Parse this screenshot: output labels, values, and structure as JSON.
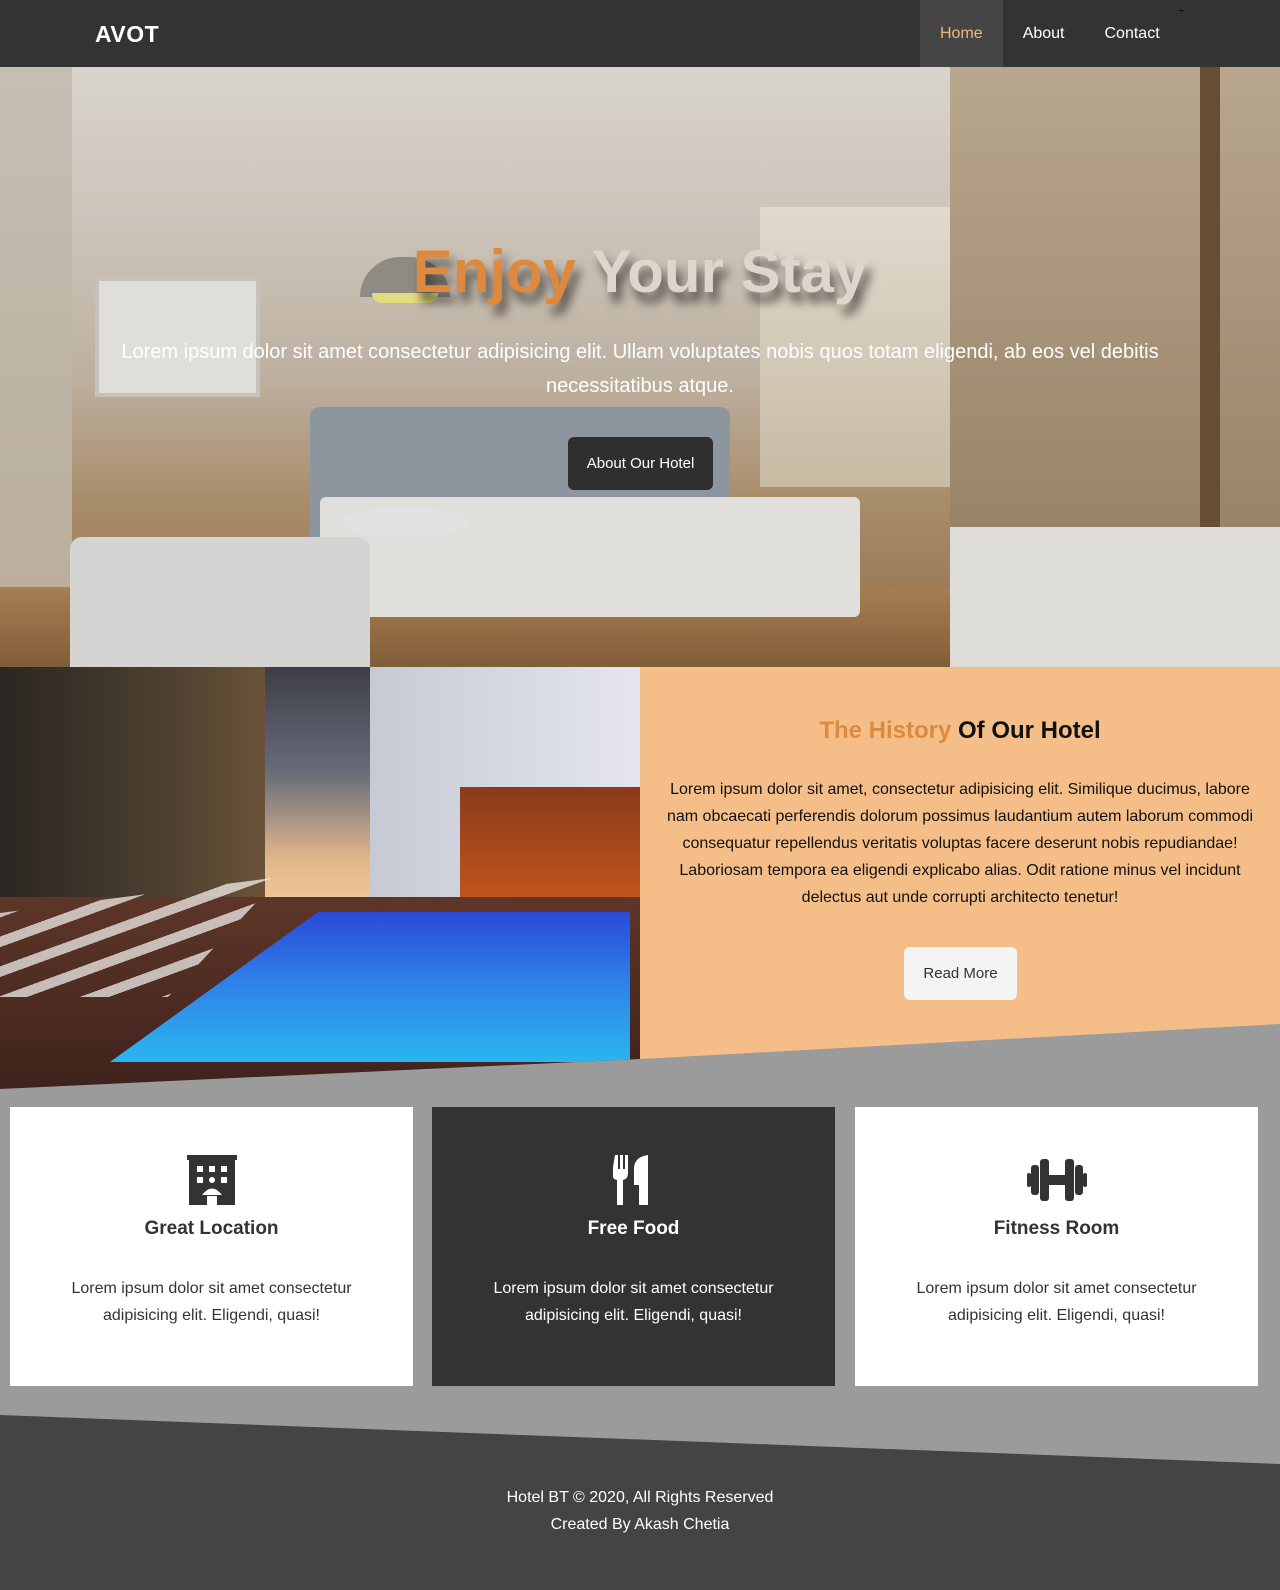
{
  "nav": {
    "logo": "AVOT",
    "links": [
      {
        "label": "Home",
        "active": true
      },
      {
        "label": "About",
        "active": false
      },
      {
        "label": "Contact",
        "active": false
      }
    ],
    "dash": "-"
  },
  "hero": {
    "title_accent": "Enjoy",
    "title_rest": "Your Stay",
    "text": "Lorem ipsum dolor sit amet consectetur adipisicing elit. Ullam voluptates nobis quos totam eligendi, ab eos vel debitis necessitatibus atque.",
    "button": "About Our Hotel"
  },
  "history": {
    "title_accent": "The History",
    "title_rest": "Of Our Hotel",
    "text": "Lorem ipsum dolor sit amet, consectetur adipisicing elit. Similique ducimus, labore nam obcaecati perferendis dolorum possimus laudantium autem laborum commodi consequatur repellendus veritatis voluptas facere deserunt nobis repudiandae! Laboriosam tempora ea eligendi explicabo alias. Odit ratione minus vel incidunt delectus aut unde corrupti architecto tenetur!",
    "button": "Read More"
  },
  "features": [
    {
      "icon": "hotel-building-icon",
      "title": "Great Location",
      "text": "Lorem ipsum dolor sit amet consectetur adipisicing elit. Eligendi, quasi!"
    },
    {
      "icon": "utensils-icon",
      "title": "Free Food",
      "text": "Lorem ipsum dolor sit amet consectetur adipisicing elit. Eligendi, quasi!"
    },
    {
      "icon": "dumbbell-icon",
      "title": "Fitness Room",
      "text": "Lorem ipsum dolor sit amet consectetur adipisicing elit. Eligendi, quasi!"
    }
  ],
  "footer": {
    "copyright": "Hotel BT © 2020, All Rights Reserved",
    "credit": "Created By Akash Chetia"
  },
  "colors": {
    "accent": "#dd8a3e",
    "nav_bg": "#333333",
    "active_link": "#f5b57a",
    "history_bg": "#f5be88",
    "section_bg": "#9b9b9b",
    "footer_bg": "#444444"
  }
}
